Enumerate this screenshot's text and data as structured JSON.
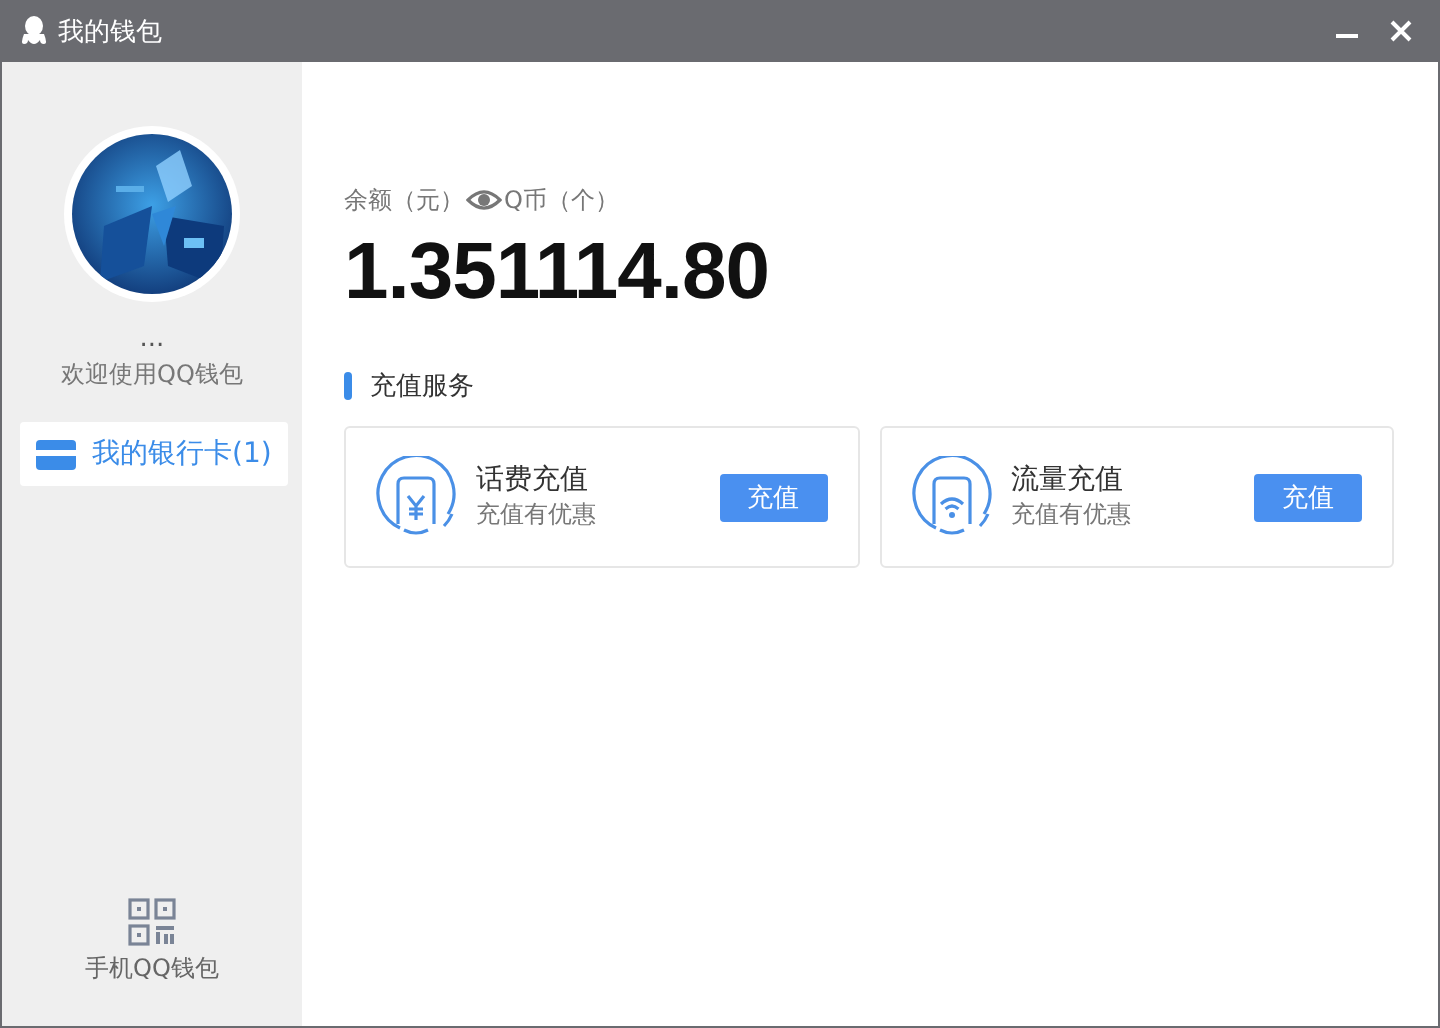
{
  "window": {
    "title": "我的钱包"
  },
  "sidebar": {
    "user_name": "...",
    "welcome": "欢迎使用QQ钱包",
    "items": [
      {
        "label": "我的银行卡(1)",
        "selected": true
      }
    ],
    "footer": "手机QQ钱包"
  },
  "balance": {
    "label_yuan": "余额（元）",
    "label_qcoin": "Q币（个）",
    "amount": "1.351114.80"
  },
  "section": {
    "title": "充值服务"
  },
  "services": [
    {
      "kind": "phone-bill",
      "title": "话费充值",
      "subtitle": "充值有优惠",
      "button": "充值"
    },
    {
      "kind": "data",
      "title": "流量充值",
      "subtitle": "充值有优惠",
      "button": "充值"
    }
  ]
}
